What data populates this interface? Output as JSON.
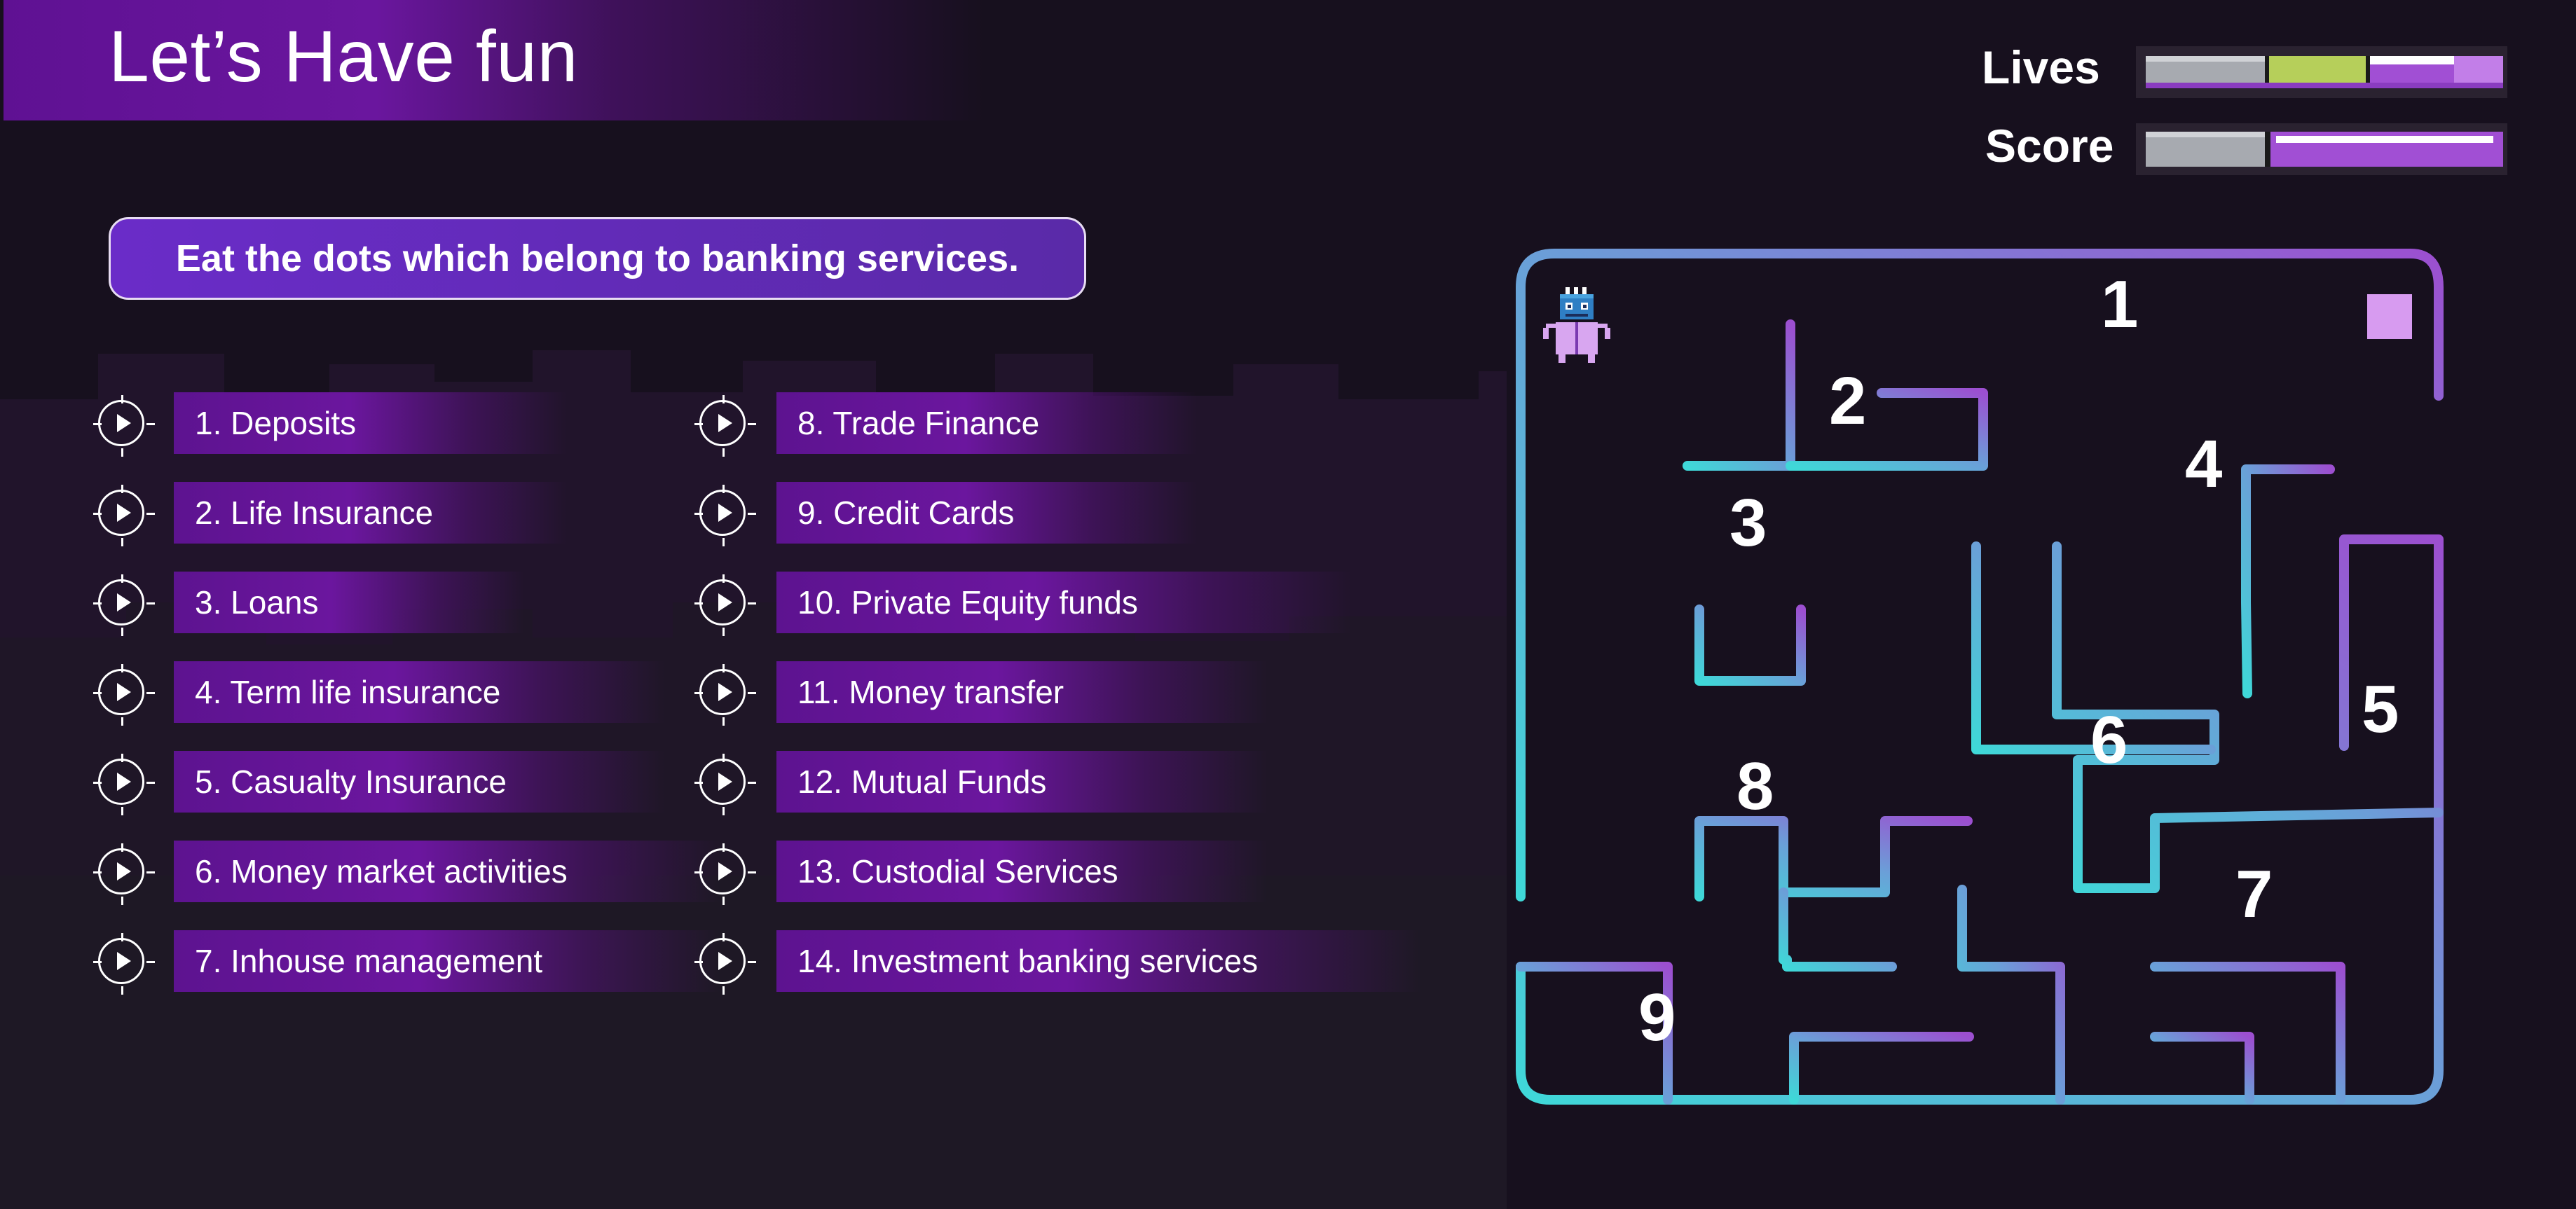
{
  "header": {
    "title": "Let’s Have fun"
  },
  "hud": {
    "lives_label": "Lives",
    "score_label": "Score"
  },
  "instruction": "Eat the dots which belong to banking services.",
  "options": [
    {
      "label": "1. Deposits"
    },
    {
      "label": "2. Life Insurance"
    },
    {
      "label": "3. Loans"
    },
    {
      "label": "4. Term life insurance"
    },
    {
      "label": "5. Casualty Insurance"
    },
    {
      "label": "6. Money market activities"
    },
    {
      "label": "7. Inhouse management"
    },
    {
      "label": "8. Trade Finance"
    },
    {
      "label": "9. Credit Cards"
    },
    {
      "label": "10. Private Equity funds"
    },
    {
      "label": "11. Money transfer"
    },
    {
      "label": "12. Mutual Funds"
    },
    {
      "label": "13. Custodial Services"
    },
    {
      "label": "14. Investment banking services"
    }
  ],
  "maze": {
    "numbers": [
      "1",
      "2",
      "3",
      "4",
      "5",
      "6",
      "7",
      "8",
      "9"
    ],
    "colors": {
      "start": "#3fd8d8",
      "end": "#9c4fd0"
    }
  },
  "colors": {
    "background": "#17101e",
    "accent_purple": "#6b169e",
    "lives_fill": "#b6cf5a",
    "bar_gray": "#a7aab0",
    "bar_purple": "#a14fd4",
    "goal": "#d79bf0"
  },
  "icons": {
    "option_icon": "play-target-icon",
    "player": "robot-icon",
    "goal": "goal-square-icon"
  }
}
